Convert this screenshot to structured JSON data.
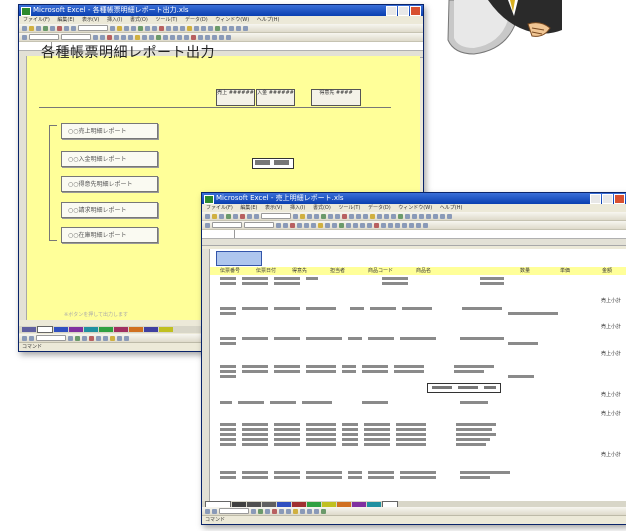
{
  "back_window": {
    "title": "Microsoft Excel - 各種帳票明細レポート出力.xls",
    "menu": [
      "ファイル(F)",
      "編集(E)",
      "表示(V)",
      "挿入(I)",
      "書式(O)",
      "ツール(T)",
      "データ(D)",
      "ウィンドウ(W)",
      "ヘルプ(H)"
    ],
    "page_title": "各種帳票明細レポート出力",
    "header_buttons": [
      "売上 ######",
      "入金 ######",
      "得意先 ####"
    ],
    "report_buttons": [
      "○○売上明細レポート",
      "○○入金明細レポート",
      "○○得意先明細レポート",
      "○○請求明細レポート",
      "○○在庫明細レポート"
    ],
    "footnote": "※ボタンを押して出力します",
    "status": "コマンド"
  },
  "front_window": {
    "title": "Microsoft Excel - 売上明細レポート.xls",
    "menu": [
      "ファイル(F)",
      "編集(E)",
      "表示(V)",
      "挿入(I)",
      "書式(O)",
      "ツール(T)",
      "データ(D)",
      "ウィンドウ(W)",
      "ヘルプ(H)"
    ],
    "columns": [
      "伝票番号",
      "伝票日付",
      "得意先",
      "担当者",
      "商品コード",
      "商品名",
      "数量",
      "単価",
      "金額"
    ],
    "subtotal_label": "売上小計",
    "status": "コマンド"
  },
  "colors": {
    "sheet_yellow": "#ffff99",
    "titlebar_blue": "#0a3fb0",
    "selection_blue": "#aec6ee"
  },
  "icons": [
    "excel-app-icon",
    "minimize-icon",
    "maximize-icon",
    "close-icon",
    "character-illustration"
  ]
}
